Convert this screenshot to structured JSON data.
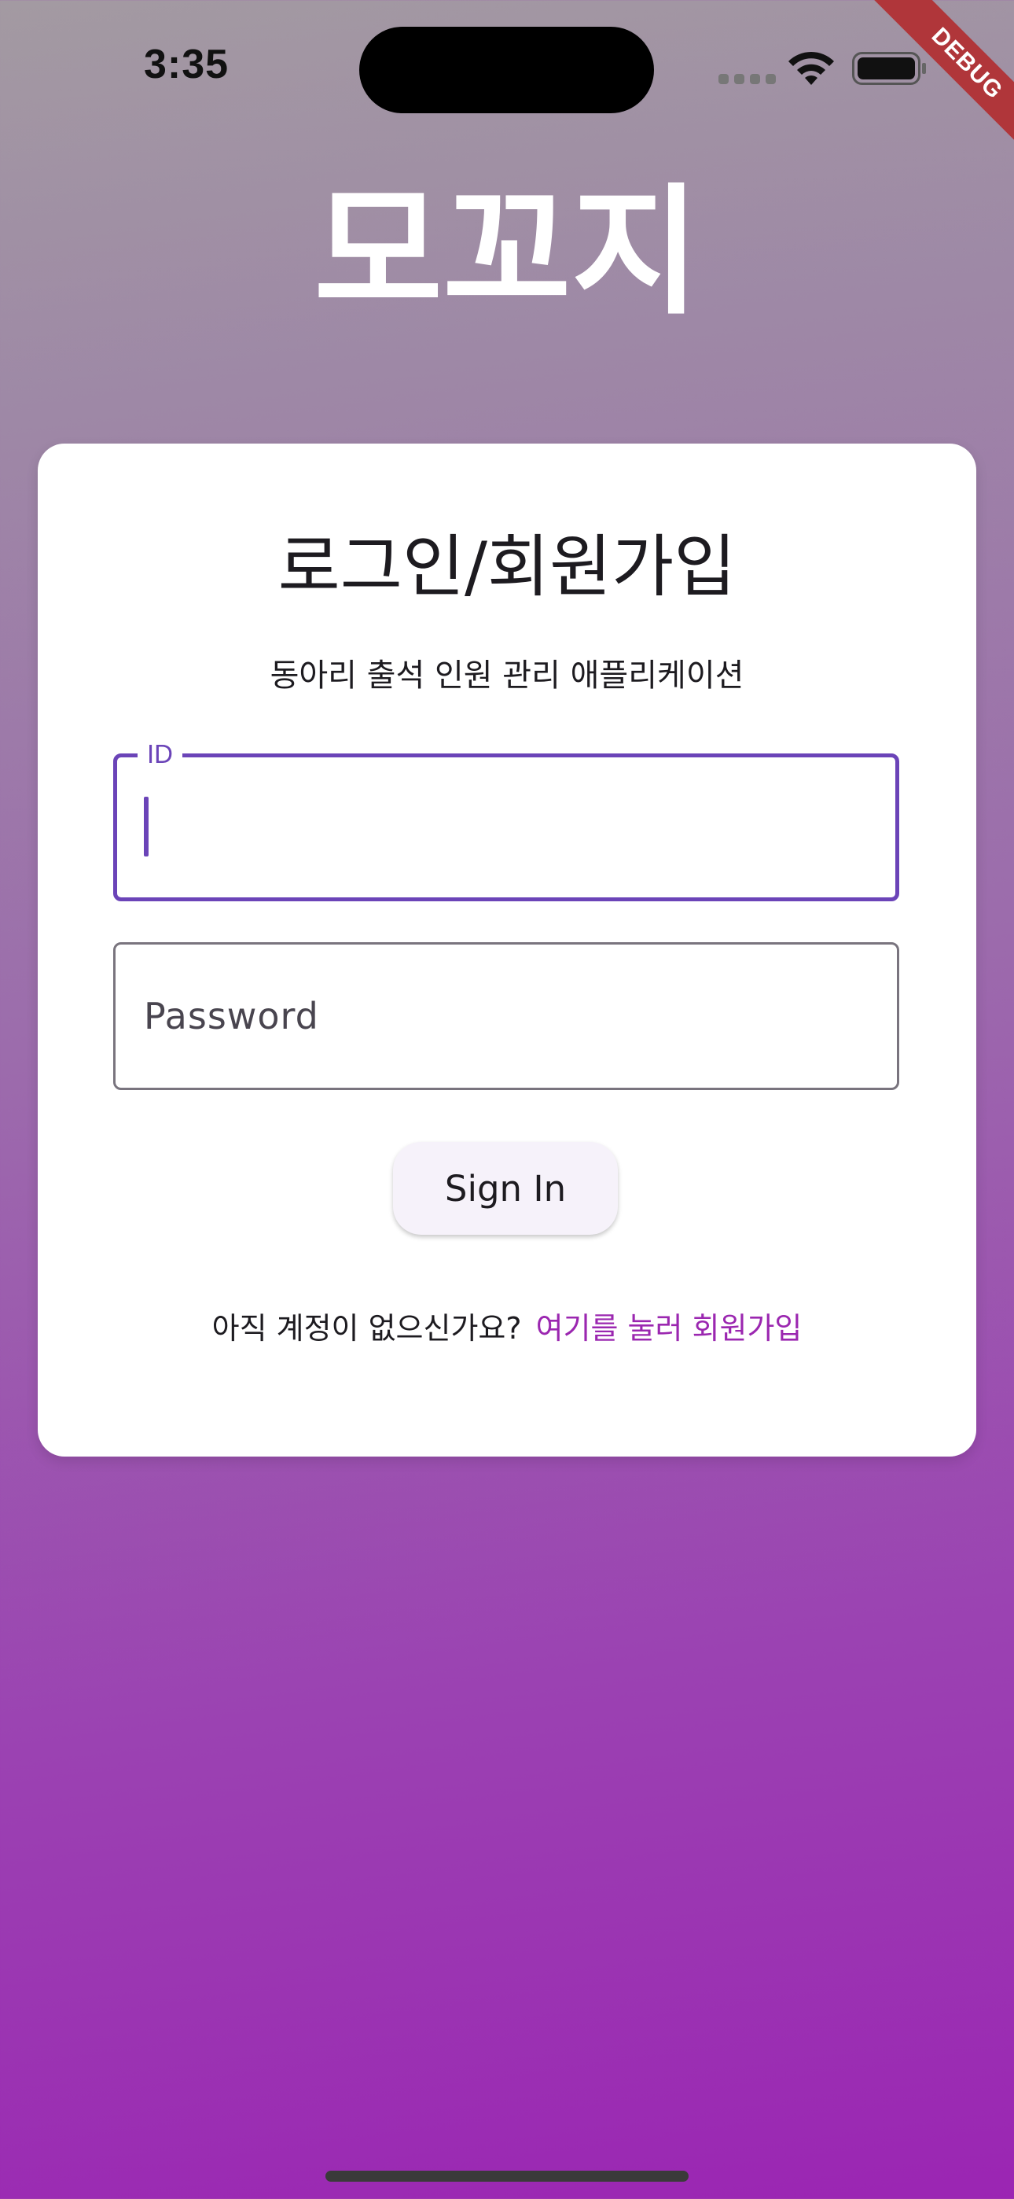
{
  "status_bar": {
    "time": "3:35",
    "debug_label": "DEBUG",
    "icons": [
      "signal-dots-icon",
      "wifi-icon",
      "battery-icon"
    ]
  },
  "app": {
    "title": "모꼬지"
  },
  "login_card": {
    "title": "로그인/회원가입",
    "subtitle": "동아리 출석 인원 관리 애플리케이션",
    "id_field": {
      "label": "ID",
      "value": ""
    },
    "password_field": {
      "placeholder": "Password",
      "value": ""
    },
    "sign_in_label": "Sign In",
    "signup_prompt": "아직 계정이 없으신가요?",
    "signup_link": "여기를 눌러 회원가입"
  },
  "colors": {
    "accent": "#6b44b8",
    "link": "#9b27b0",
    "background_top": "#a39aa2",
    "background_bottom": "#9b25b3",
    "debug_banner": "#b0363a"
  }
}
